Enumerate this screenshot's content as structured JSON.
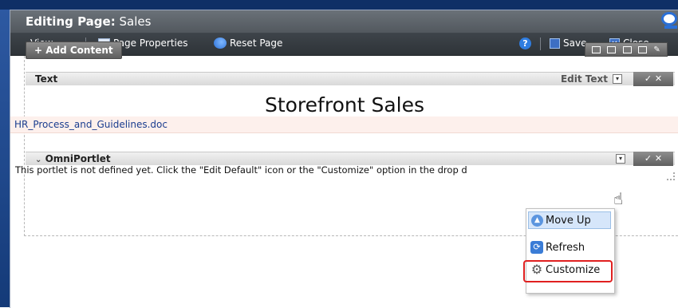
{
  "window": {
    "title_prefix": "Editing Page:",
    "title_page": "Sales"
  },
  "toolbar": {
    "view_label": "View",
    "page_properties_label": "Page Properties",
    "reset_page_label": "Reset Page",
    "help_symbol": "?",
    "save_label": "Save",
    "close_label": "Close"
  },
  "add_content_label": "+ Add Content",
  "text_portlet": {
    "title": "Text",
    "edit_label": "Edit Text",
    "actions": "✓ ✕"
  },
  "storefront_heading": "Storefront  Sales",
  "document_link": "HR_Process_and_Guidelines.doc",
  "omni_portlet": {
    "title": "OmniPortlet",
    "message": "This portlet is not defined yet. Click the \"Edit Default\" icon or the \"Customize\" option in the drop d",
    "actions": "✓ ✕"
  },
  "context_menu": {
    "items": [
      {
        "label": "Move Up",
        "icon": "move-up-icon"
      },
      {
        "label": "Refresh",
        "icon": "refresh-icon"
      },
      {
        "label": "Customize",
        "icon": "gear-icon"
      }
    ]
  },
  "colors": {
    "highlight": "#e02020",
    "link": "#1a3d8f",
    "accent": "#2a6fd6"
  }
}
